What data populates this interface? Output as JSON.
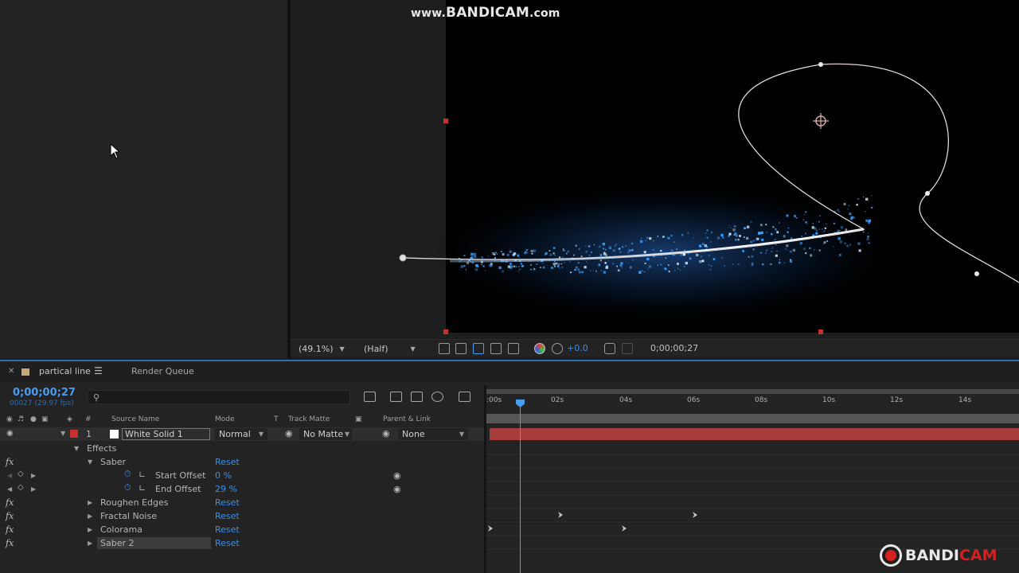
{
  "watermark": {
    "prefix": "www.",
    "brand": "BANDICAM",
    "suffix": ".com"
  },
  "viewer_toolbar": {
    "zoom": "(49.1%)",
    "resolution": "(Half)",
    "exposure": "+0.0",
    "timecode": "0;00;00;27"
  },
  "timeline": {
    "tabs": [
      {
        "label": "partical line"
      },
      {
        "label": "Render Queue"
      }
    ],
    "timecode": "0;00;00;27",
    "frames": "00027 (29.97 fps)",
    "search_placeholder": "",
    "columns": {
      "num": "#",
      "source_name": "Source Name",
      "mode": "Mode",
      "t": "T",
      "track_matte": "Track Matte",
      "parent_link": "Parent & Link"
    },
    "layer": {
      "number": "1",
      "name": "White Solid 1",
      "mode": "Normal",
      "track_matte": "No Matte",
      "parent": "None",
      "color": "#a63c3c"
    },
    "properties": {
      "effects_label": "Effects",
      "saber": {
        "label": "Saber",
        "reset": "Reset"
      },
      "start_offset": {
        "label": "Start Offset",
        "value": "0 %"
      },
      "end_offset": {
        "label": "End Offset",
        "value": "29 %"
      },
      "roughen_edges": {
        "label": "Roughen Edges",
        "reset": "Reset"
      },
      "fractal_noise": {
        "label": "Fractal Noise",
        "reset": "Reset"
      },
      "colorama": {
        "label": "Colorama",
        "reset": "Reset"
      },
      "saber2": {
        "label": "Saber 2",
        "reset": "Reset"
      }
    },
    "ruler_ticks": [
      ":00s",
      "02s",
      "04s",
      "06s",
      "08s",
      "10s",
      "12s",
      "14s"
    ]
  },
  "bandicam_logo": {
    "band": "BANDI",
    "cam": "CAM"
  },
  "colors": {
    "accent": "#4a9cf0",
    "layer_bar": "#a63c3c",
    "saber_glow": "#3aa0ff"
  }
}
